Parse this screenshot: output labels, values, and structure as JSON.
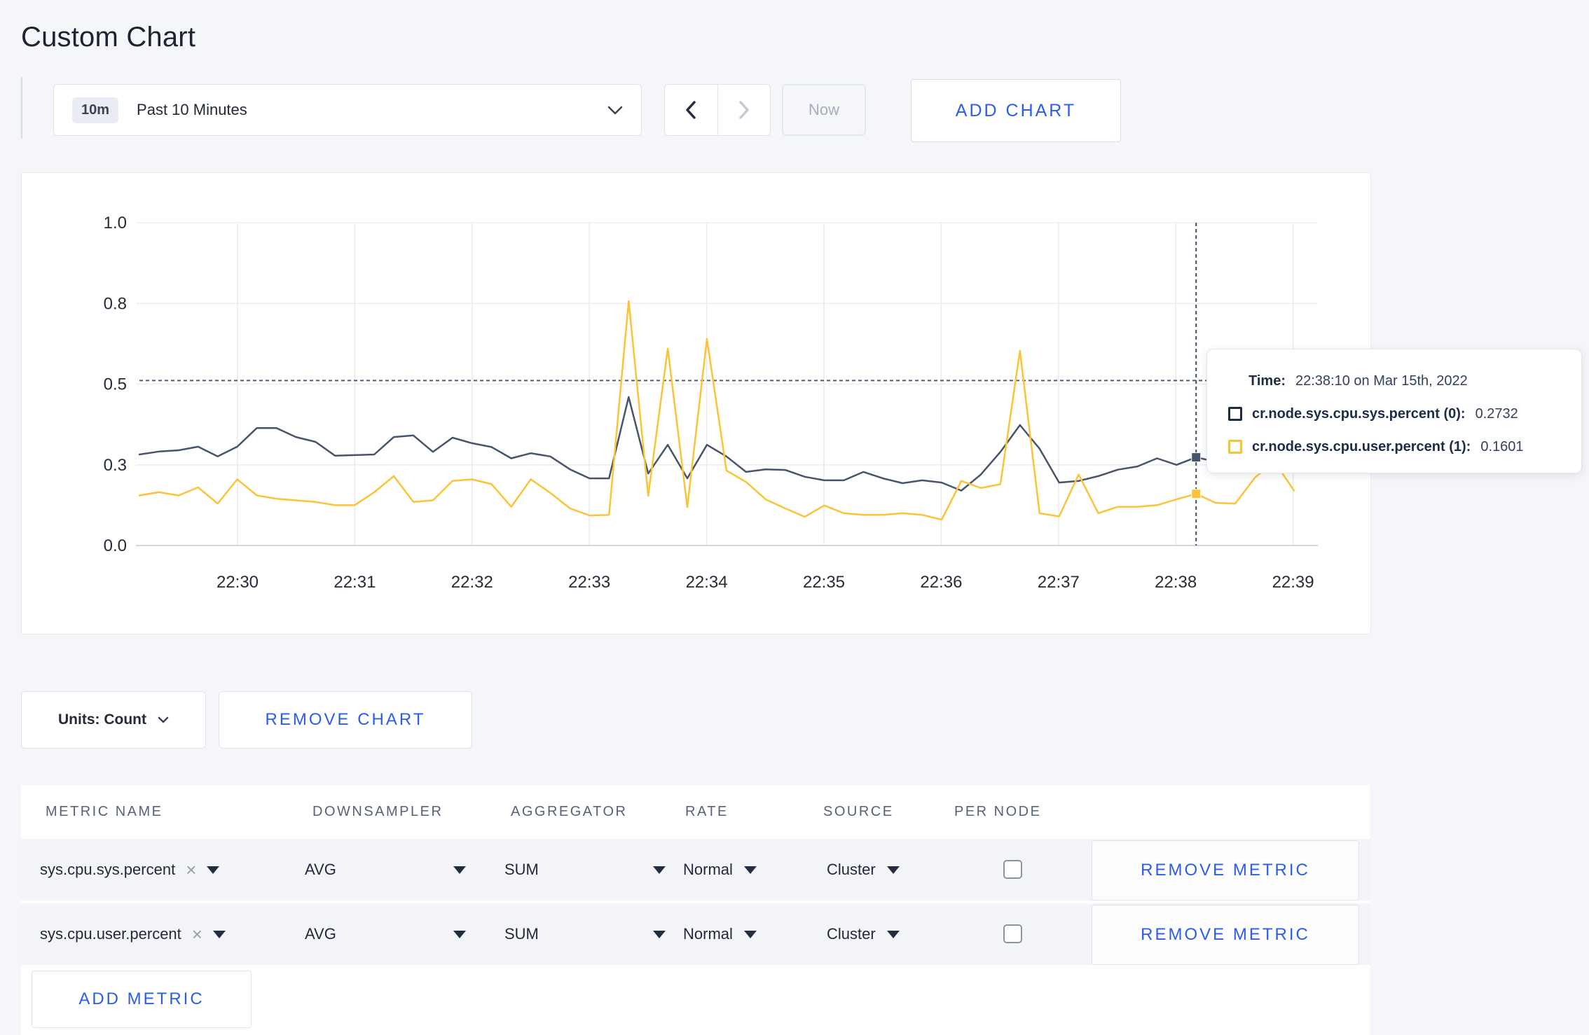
{
  "page": {
    "title": "Custom Chart"
  },
  "toolbar": {
    "time_window_badge": "10m",
    "time_window_label": "Past 10 Minutes",
    "now_label": "Now",
    "add_chart_label": "ADD CHART"
  },
  "chart_controls": {
    "units_label": "Units: Count",
    "remove_chart_label": "REMOVE CHART",
    "add_metric_label": "ADD METRIC"
  },
  "tooltip": {
    "time_label": "Time:",
    "time_value": "22:38:10 on Mar 15th, 2022",
    "series": [
      {
        "label": "cr.node.sys.cpu.sys.percent (0):",
        "value": "0.2732",
        "color": "#1b2a47"
      },
      {
        "label": "cr.node.sys.cpu.user.percent (1):",
        "value": "0.1601",
        "color": "#fbc437"
      }
    ]
  },
  "chart_data": {
    "type": "line",
    "title": "",
    "xlabel": "",
    "ylabel": "",
    "ylim": [
      0,
      1
    ],
    "grid": true,
    "x_ticks": [
      "22:30",
      "22:31",
      "22:32",
      "22:33",
      "22:34",
      "22:35",
      "22:36",
      "22:37",
      "22:38",
      "22:39"
    ],
    "y_ticks": [
      {
        "value": 0.0,
        "label": "0.0"
      },
      {
        "value": 0.25,
        "label": "0.3"
      },
      {
        "value": 0.5,
        "label": "0.5"
      },
      {
        "value": 0.75,
        "label": "0.8"
      },
      {
        "value": 1.0,
        "label": "1.0"
      }
    ],
    "x_start": "22:29:10",
    "x_interval_seconds": 10,
    "crosshair": {
      "time": "22:38:10",
      "marked_index": 54,
      "h_guide_value": 0.511
    },
    "series": [
      {
        "name": "cr.node.sys.cpu.sys.percent",
        "color": "#46546c",
        "marked_value": 0.2732,
        "values": [
          0.282,
          0.291,
          0.295,
          0.306,
          0.276,
          0.306,
          0.364,
          0.364,
          0.336,
          0.321,
          0.278,
          0.28,
          0.282,
          0.336,
          0.341,
          0.29,
          0.334,
          0.317,
          0.305,
          0.27,
          0.286,
          0.276,
          0.236,
          0.208,
          0.208,
          0.46,
          0.223,
          0.312,
          0.208,
          0.312,
          0.276,
          0.228,
          0.236,
          0.234,
          0.213,
          0.202,
          0.202,
          0.228,
          0.208,
          0.193,
          0.202,
          0.195,
          0.17,
          0.22,
          0.29,
          0.373,
          0.3,
          0.195,
          0.2,
          0.215,
          0.235,
          0.245,
          0.27,
          0.25,
          0.2732,
          0.26,
          0.27,
          0.265,
          0.27,
          0.27
        ]
      },
      {
        "name": "cr.node.sys.cpu.user.percent",
        "color": "#fbc437",
        "marked_value": 0.1601,
        "values": [
          0.155,
          0.165,
          0.155,
          0.18,
          0.13,
          0.205,
          0.155,
          0.145,
          0.14,
          0.135,
          0.125,
          0.125,
          0.165,
          0.215,
          0.135,
          0.14,
          0.2,
          0.205,
          0.19,
          0.12,
          0.205,
          0.163,
          0.115,
          0.093,
          0.095,
          0.757,
          0.154,
          0.61,
          0.119,
          0.64,
          0.232,
          0.197,
          0.143,
          0.115,
          0.089,
          0.124,
          0.1,
          0.095,
          0.095,
          0.1,
          0.095,
          0.08,
          0.2,
          0.178,
          0.19,
          0.603,
          0.1,
          0.09,
          0.22,
          0.1,
          0.12,
          0.12,
          0.125,
          0.143,
          0.1601,
          0.132,
          0.13,
          0.21,
          0.26,
          0.17
        ]
      }
    ],
    "legend_position": "tooltip-only"
  },
  "metrics_table": {
    "columns": [
      "METRIC NAME",
      "DOWNSAMPLER",
      "AGGREGATOR",
      "RATE",
      "SOURCE",
      "PER NODE"
    ],
    "rows": [
      {
        "metric_name": "sys.cpu.sys.percent",
        "downsampler": "AVG",
        "aggregator": "SUM",
        "rate": "Normal",
        "source": "Cluster",
        "per_node_checked": false,
        "remove_label": "REMOVE METRIC"
      },
      {
        "metric_name": "sys.cpu.user.percent",
        "downsampler": "AVG",
        "aggregator": "SUM",
        "rate": "Normal",
        "source": "Cluster",
        "per_node_checked": false,
        "remove_label": "REMOVE METRIC"
      }
    ]
  }
}
